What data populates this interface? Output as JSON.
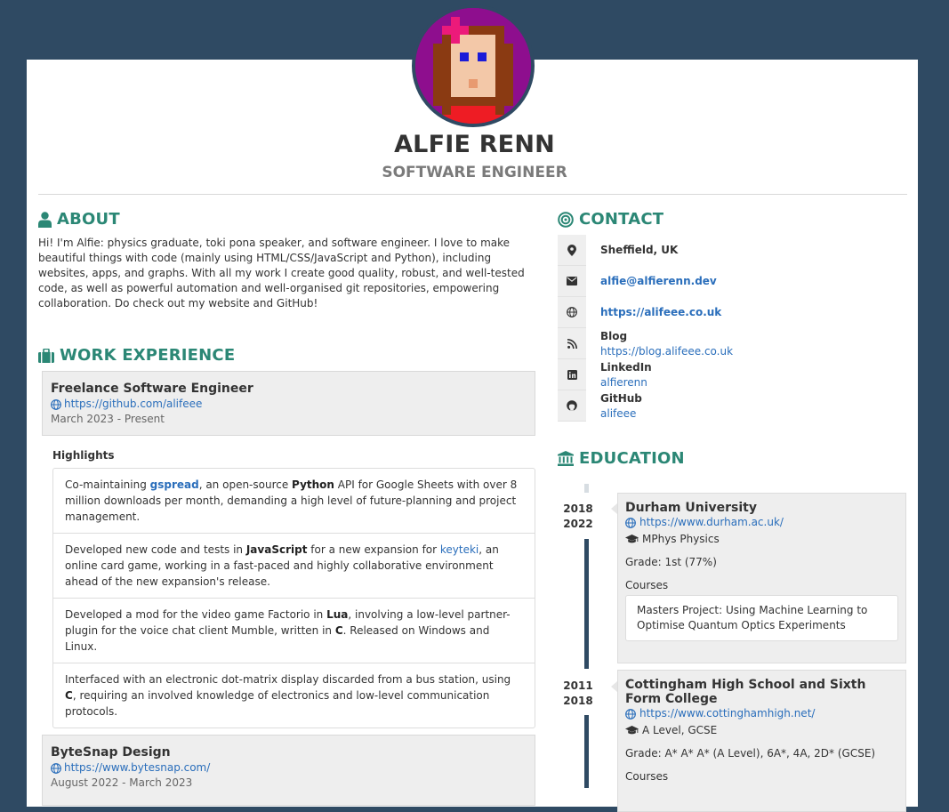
{
  "header": {
    "name": "ALFIE RENN",
    "role": "SOFTWARE ENGINEER"
  },
  "about": {
    "title": "ABOUT",
    "text": "Hi! I'm Alfie: physics graduate, toki pona speaker, and software engineer. I love to make beautiful things with code (mainly using HTML/CSS/JavaScript and Python), including websites, apps, and graphs. With all my work I create good quality, robust, and well-tested code, as well as powerful automation and well-organised git repositories, empowering collaboration. Do check out my website and GitHub!"
  },
  "work": {
    "title": "WORK EXPERIENCE",
    "jobs": [
      {
        "title": "Freelance Software Engineer",
        "url": "https://github.com/alifeee",
        "dates": "March 2023 - Present"
      },
      {
        "title": "ByteSnap Design",
        "url": "https://www.bytesnap.com/",
        "dates": "August 2022 - March 2023"
      }
    ],
    "highlights_label": "Highlights",
    "highlights": [
      {
        "p1": "Co-maintaining ",
        "link": "gspread",
        "p2": ", an open-source ",
        "bold": "Python",
        "p3": " API for Google Sheets with over 8 million downloads per month, demanding a high level of future-planning and project management."
      },
      {
        "p1": "Developed new code and tests in ",
        "bold": "JavaScript",
        "p2": " for a new expansion for ",
        "link": "keyteki",
        "p3": ", an online card game, working in a fast-paced and highly collaborative environment ahead of the new expansion's release."
      },
      {
        "p1": "Developed a mod for the video game Factorio in ",
        "bold": "Lua",
        "p2": ", involving a low-level partner-plugin for the voice chat client Mumble, written in ",
        "bold2": "C",
        "p3": ". Released on Windows and Linux."
      },
      {
        "p1": "Interfaced with an electronic dot-matrix display discarded from a bus station, using ",
        "bold": "C",
        "p2": ", requiring an involved knowledge of electronics and low-level communication protocols."
      }
    ]
  },
  "contact": {
    "title": "CONTACT",
    "location": "Sheffield, UK",
    "email": "alfie@alfierenn.dev",
    "website": "https://alifeee.co.uk",
    "blog_label": "Blog",
    "blog": "https://blog.alifeee.co.uk",
    "linkedin_label": "LinkedIn",
    "linkedin": "alfierenn",
    "github_label": "GitHub",
    "github": "alifeee"
  },
  "education": {
    "title": "EDUCATION",
    "items": [
      {
        "start": "2018",
        "end": "2022",
        "school": "Durham University",
        "url": "https://www.durham.ac.uk/",
        "degree": "MPhys Physics",
        "grade": "Grade: 1st (77%)",
        "courses_label": "Courses",
        "courses": "Masters Project: Using Machine Learning to Optimise Quantum Optics Experiments"
      },
      {
        "start": "2011",
        "end": "2018",
        "school": "Cottingham High School and Sixth Form College",
        "url": "https://www.cottinghamhigh.net/",
        "degree": "A Level, GCSE",
        "grade": "Grade: A* A* A* (A Level), 6A*, 4A, 2D* (GCSE)",
        "courses_label": "Courses"
      }
    ]
  },
  "colors": {
    "background": "#2f4a63",
    "accent": "#2b8775",
    "link": "#2a6ebb",
    "avatar_bg": "#8e0e8e"
  }
}
